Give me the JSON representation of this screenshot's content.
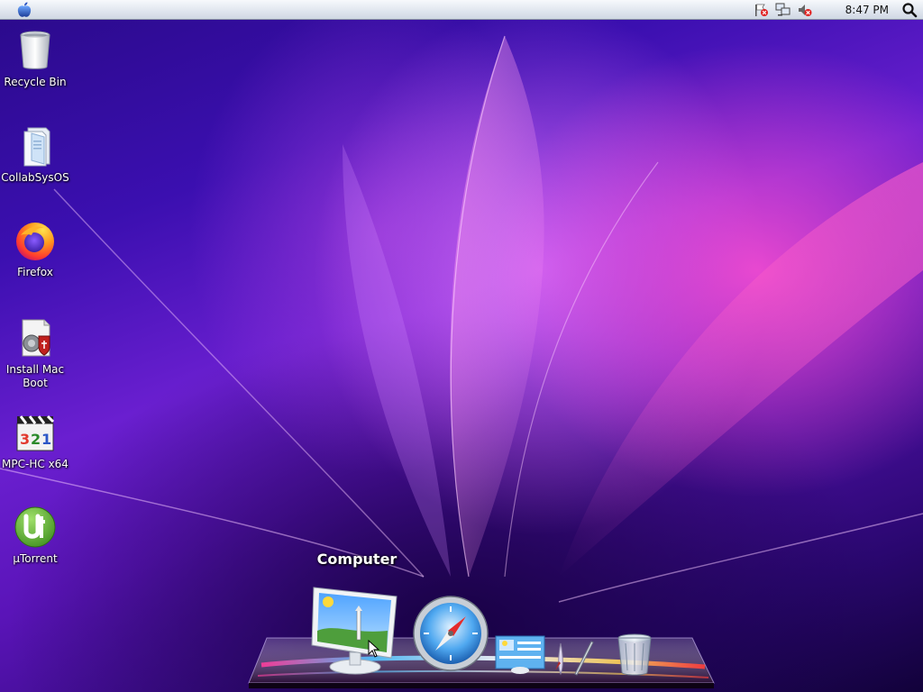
{
  "menubar": {
    "clock": "8:47 PM",
    "tray_icons": [
      "flag-error-icon",
      "network-icon",
      "volume-muted-icon"
    ]
  },
  "desktop_icons": [
    {
      "label": "Recycle Bin",
      "icon": "recycle-bin-icon"
    },
    {
      "label": "CollabSysOS",
      "icon": "folder-icon"
    },
    {
      "label": "Firefox",
      "icon": "firefox-icon"
    },
    {
      "label": "Install Mac Boot",
      "icon": "install-mac-boot-icon"
    },
    {
      "label": "MPC-HC x64",
      "icon": "mpc-hc-icon"
    },
    {
      "label": "µTorrent",
      "icon": "utorrent-icon"
    }
  ],
  "dock": {
    "tooltip": "Computer",
    "items": [
      "computer-icon",
      "safari-icon",
      "mail-icon",
      "draw-icon",
      "trash-icon"
    ]
  },
  "colors": {
    "wallpaper_primary": "#3b0fb0",
    "wallpaper_accent": "#ff50d2",
    "label_text": "#ffffff"
  }
}
